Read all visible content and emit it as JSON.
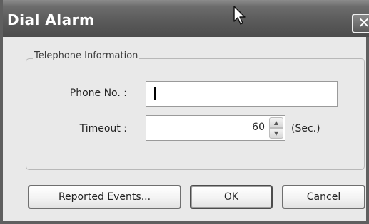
{
  "window": {
    "title": "Dial Alarm",
    "close_glyph": "✕"
  },
  "group": {
    "label": "Telephone Information"
  },
  "phone": {
    "label": "Phone No. :",
    "value": ""
  },
  "timeout": {
    "label": "Timeout :",
    "value": "60",
    "units": "(Sec.)"
  },
  "buttons": {
    "reported_events": "Reported Events...",
    "ok": "OK",
    "cancel": "Cancel"
  },
  "icons": {
    "close": "close-icon",
    "cursor": "mouse-pointer-icon",
    "spin_up": "arrow-up-icon",
    "spin_down": "arrow-down-icon"
  },
  "colors": {
    "titlebar": "#5b5b5b",
    "dialog_background": "#e9e9e9",
    "title_text": "#ffffff"
  }
}
